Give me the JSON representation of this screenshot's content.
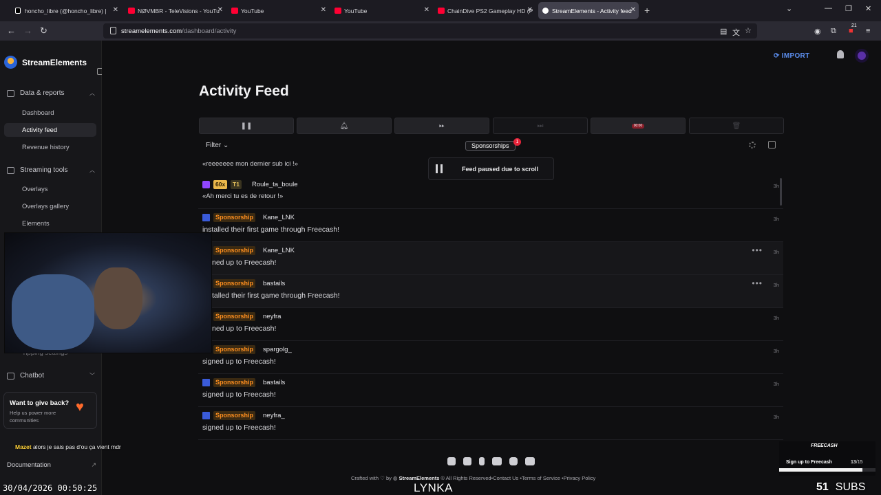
{
  "browser": {
    "tabs": [
      {
        "title": "honcho_libre (@honcho_libre) |",
        "favicon": "tiktok-icon"
      },
      {
        "title": "NØVMBR - TeleVisions - YouTu",
        "favicon": "youtube-icon"
      },
      {
        "title": "YouTube",
        "favicon": "youtube-icon"
      },
      {
        "title": "YouTube",
        "favicon": "youtube-icon"
      },
      {
        "title": "ChainDive PS2 Gameplay HD (P",
        "favicon": "youtube-icon"
      },
      {
        "title": "StreamElements - Activity feed",
        "favicon": "streamelements-icon",
        "active": true
      }
    ],
    "url_domain": "streamelements.com",
    "url_path": "/dashboard/activity",
    "extension_badge": "21"
  },
  "sidebar": {
    "brand": "StreamElements",
    "sections": [
      {
        "label": "Data & reports",
        "icon": "chart-icon",
        "items": [
          "Dashboard",
          "Activity feed",
          "Revenue history"
        ]
      },
      {
        "label": "Streaming tools",
        "icon": "tools-icon",
        "items": [
          "Overlays",
          "Overlays gallery",
          "Elements"
        ]
      }
    ],
    "active_item": "Activity feed",
    "chatbot_label": "Chatbot",
    "partial_label": "Tipping settings",
    "give_back": {
      "title": "Want to give back?",
      "subtitle": "Help us power more communities"
    },
    "documentation": "Documentation"
  },
  "header": {
    "import_label": "IMPORT"
  },
  "page": {
    "title": "Activity Feed",
    "controls": [
      "pause-icon",
      "bell-icon",
      "skip-icon",
      "next-icon",
      "record-icon",
      "trash-icon"
    ],
    "record_label": "00:00",
    "filter_label": "Filter",
    "sponsorships_tag": "Sponsorships",
    "sponsorships_count": "1",
    "paused_message": "Feed paused due to scroll",
    "top_message": "«reeeeeee mon dernier sub ici !»"
  },
  "feed": [
    {
      "platform": "twitch",
      "badge": "60x",
      "tier": "T1",
      "user": "Roule_ta_boule",
      "message": "«Ah merci tu es de retour !»",
      "time": "3h"
    },
    {
      "platform": "se",
      "type": "Sponsorship",
      "user": "Kane_LNK",
      "message": "installed their first game through Freecash!",
      "time": "3h"
    },
    {
      "platform": "se",
      "type": "Sponsorship",
      "user": "Kane_LNK",
      "message": "ned up to Freecash!",
      "time": "3h",
      "highlight": true
    },
    {
      "platform": "se",
      "type": "Sponsorship",
      "user": "bastails",
      "message": "talled their first game through Freecash!",
      "time": "3h",
      "highlight": true
    },
    {
      "platform": "se",
      "type": "Sponsorship",
      "user": "neyfra",
      "message": "ned up to Freecash!",
      "time": "3h"
    },
    {
      "platform": "se",
      "type": "Sponsorship",
      "user": "spargolg_",
      "message": "signed up to Freecash!",
      "time": "3h"
    },
    {
      "platform": "se",
      "type": "Sponsorship",
      "user": "bastails",
      "message": "signed up to Freecash!",
      "time": "3h"
    },
    {
      "platform": "se",
      "type": "Sponsorship",
      "user": "neyfra_",
      "message": "signed up to Freecash!",
      "time": "3h"
    }
  ],
  "footer": {
    "social_icons": [
      "twitch-icon",
      "x-icon",
      "facebook-icon",
      "youtube-icon",
      "instagram-icon",
      "discord-icon"
    ],
    "crafted": "Crafted with",
    "by": "by",
    "brand": "StreamElements",
    "rights": "© All Rights Reserved",
    "contact": "Contact Us",
    "terms": "Terms of Service",
    "privacy": "Privacy Policy"
  },
  "stream_overlay": {
    "chat_nick": "Mazet",
    "chat_text": "alors je sais pas d'ou ça vient mdr",
    "clock": "30/04/2026 00:50:25",
    "streamer_name": "LYNKA",
    "subs_count": "51",
    "subs_label": "SUBS",
    "freecash_logo": "FREECASH",
    "freecash_title": "Sign up to Freecash",
    "freecash_done": "13",
    "freecash_total": "/15",
    "freecash_progress": 0.8667
  },
  "colors": {
    "accent": "#5c8ff0",
    "sponsorship": "#ff8f1f",
    "twitch": "#9146ff"
  }
}
